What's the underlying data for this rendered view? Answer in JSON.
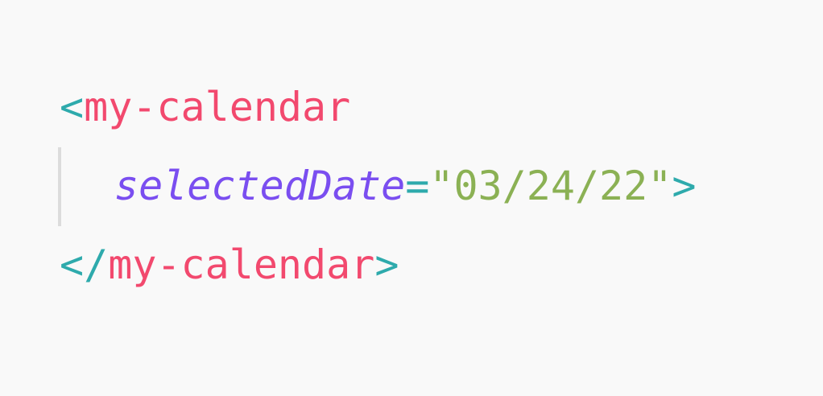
{
  "code": {
    "line1": {
      "open_bracket": "<",
      "tag_name": "my-calendar"
    },
    "line2": {
      "attribute": "selectedDate",
      "equals": "=",
      "value": "\"03/24/22\"",
      "close_bracket": ">"
    },
    "line3": {
      "open_bracket": "</",
      "tag_name": "my-calendar",
      "close_bracket": ">"
    }
  },
  "colors": {
    "background": "#f9f9f9",
    "punctuation": "#2eaaac",
    "tag": "#f2496e",
    "attribute": "#7a4ef0",
    "string": "#8bb154",
    "indent_guide": "#dcdcdc"
  }
}
